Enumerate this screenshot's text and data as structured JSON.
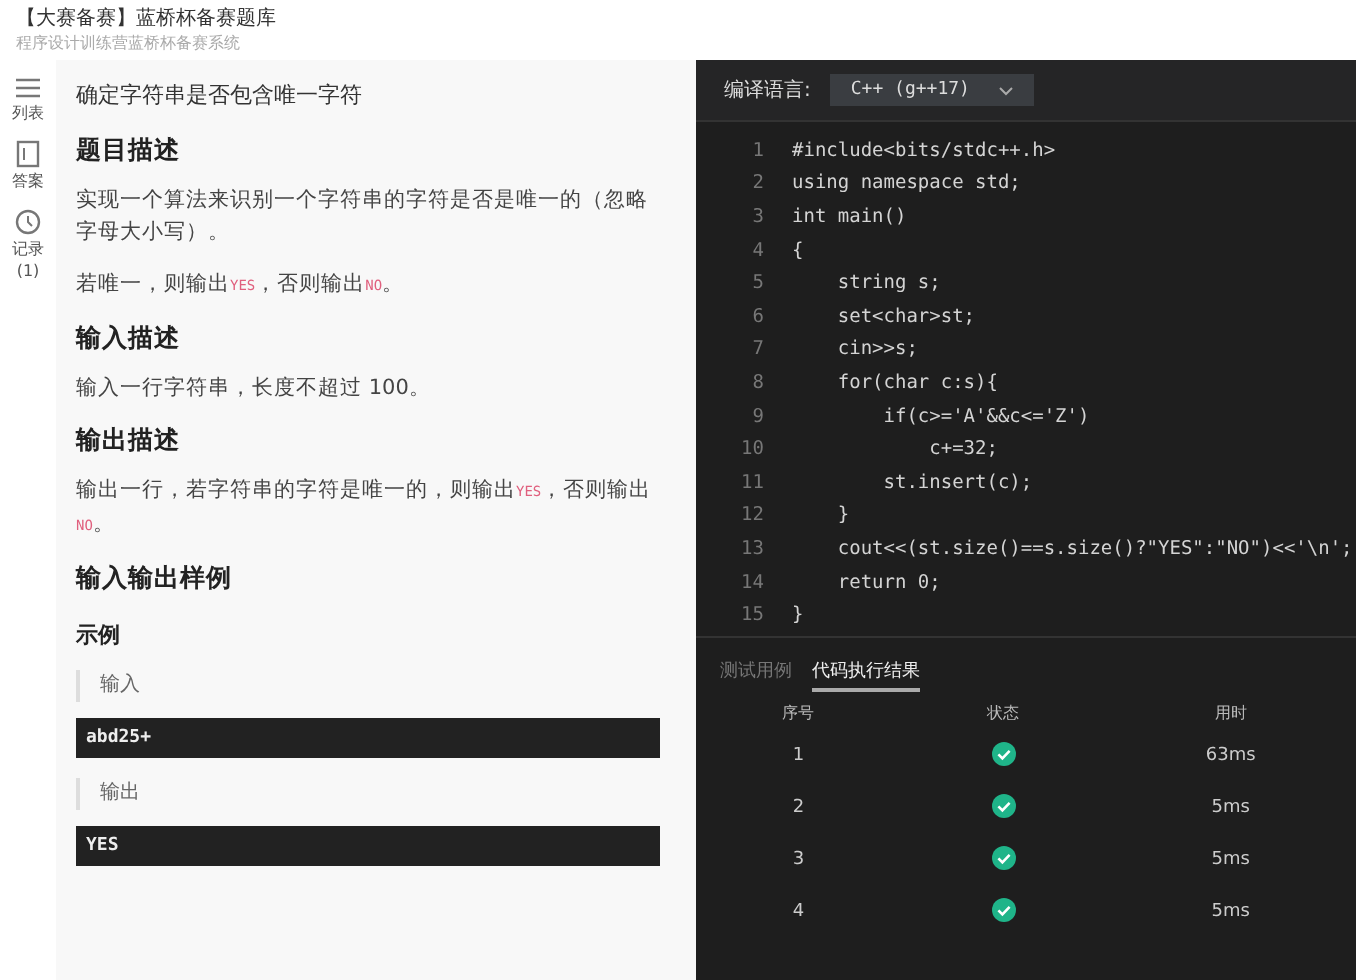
{
  "header": {
    "title": "【大赛备赛】蓝桥杯备赛题库",
    "subtitle": "程序设计训练营蓝桥杯备赛系统"
  },
  "nav": [
    {
      "label": "列表",
      "kind": "list"
    },
    {
      "label": "答案",
      "kind": "doc"
    },
    {
      "label": "记录",
      "count": "(1)",
      "kind": "history"
    }
  ],
  "problem": {
    "title": "确定字符串是否包含唯一字符",
    "sections": [
      {
        "heading": "题目描述",
        "paragraphs": [
          [
            {
              "kind": "plain",
              "text": "实现一个算法来识别一个字符串的字符是否是唯一的（忽略字母大小写）。"
            }
          ],
          [
            {
              "kind": "plain",
              "text": "若唯一，则输出"
            },
            {
              "kind": "code",
              "text": "YES"
            },
            {
              "kind": "plain",
              "text": "，否则输出"
            },
            {
              "kind": "code",
              "text": "NO"
            },
            {
              "kind": "plain",
              "text": "。"
            }
          ]
        ]
      },
      {
        "heading": "输入描述",
        "paragraphs": [
          [
            {
              "kind": "plain",
              "text": "输入一行字符串，长度不超过 100。"
            }
          ]
        ]
      },
      {
        "heading": "输出描述",
        "paragraphs": [
          [
            {
              "kind": "plain",
              "text": "输出一行，若字符串的字符是唯一的，则输出"
            },
            {
              "kind": "code",
              "text": "YES"
            },
            {
              "kind": "plain",
              "text": "，否则输出"
            },
            {
              "kind": "code",
              "text": "NO"
            },
            {
              "kind": "plain",
              "text": "。"
            }
          ]
        ]
      },
      {
        "heading": "输入输出样例"
      }
    ],
    "example": {
      "heading": "示例",
      "input_label": "输入",
      "input": "abd25+",
      "output_label": "输出",
      "output": "YES"
    }
  },
  "editor": {
    "language_label": "编译语言:",
    "language": "C++ (g++17)",
    "lines": [
      {
        "number": "1",
        "text": "#include<bits/stdc++.h>"
      },
      {
        "number": "2",
        "text": "using namespace std;"
      },
      {
        "number": "3",
        "text": "int main()"
      },
      {
        "number": "4",
        "text": "{"
      },
      {
        "number": "5",
        "text": "    string s;"
      },
      {
        "number": "6",
        "text": "    set<char>st;"
      },
      {
        "number": "7",
        "text": "    cin>>s;"
      },
      {
        "number": "8",
        "text": "    for(char c:s){"
      },
      {
        "number": "9",
        "text": "        if(c>='A'&&c<='Z')"
      },
      {
        "number": "10",
        "text": "            c+=32;"
      },
      {
        "number": "11",
        "text": "        st.insert(c);"
      },
      {
        "number": "12",
        "text": "    }"
      },
      {
        "number": "13",
        "text": "    cout<<(st.size()==s.size()?\"YES\":\"NO\")<<'\\n';"
      },
      {
        "number": "14",
        "text": "    return 0;"
      },
      {
        "number": "15",
        "text": "}"
      }
    ]
  },
  "results": {
    "tabs": [
      {
        "label": "测试用例",
        "selected": false
      },
      {
        "label": "代码执行结果",
        "selected": true
      }
    ],
    "columns": [
      "序号",
      "状态",
      "用时"
    ],
    "rows": [
      {
        "index": "1",
        "passed": true,
        "time": "63ms"
      },
      {
        "index": "2",
        "passed": true,
        "time": "5ms"
      },
      {
        "index": "3",
        "passed": true,
        "time": "5ms"
      },
      {
        "index": "4",
        "passed": true,
        "time": "5ms"
      }
    ]
  }
}
